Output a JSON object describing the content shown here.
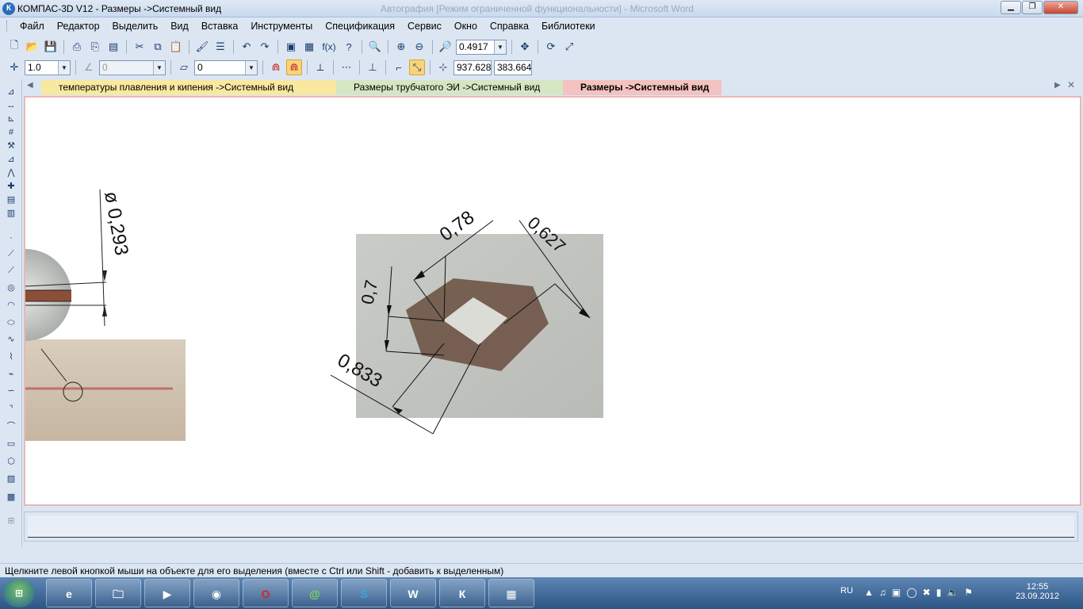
{
  "window": {
    "title": "КОМПАС-3D V12 - Размеры ->Системный вид",
    "ghost_title": "Автография [Режим ограниченной функциональности] - Microsoft Word",
    "app_icon": "kompas-logo-icon"
  },
  "menu": [
    "Файл",
    "Редактор",
    "Выделить",
    "Вид",
    "Вставка",
    "Инструменты",
    "Спецификация",
    "Сервис",
    "Окно",
    "Справка",
    "Библиотеки"
  ],
  "toolbar": {
    "zoom_value": "0.4917",
    "step_value": "1.0",
    "angle_value": "0",
    "layer_value": "0",
    "x_coord": "937.628",
    "y_coord": "383.664",
    "fx_label": "f(x)"
  },
  "tabs": [
    {
      "label": "температуры плавления и кипения ->Системный вид",
      "color": "#f9e8a0"
    },
    {
      "label": "Размеры трубчатого ЭИ ->Системный вид",
      "color": "#d5e6c2"
    },
    {
      "label": "Размеры ->Системный вид",
      "color": "#f4c2c0"
    }
  ],
  "drawing": {
    "left_dimension": "ø 0,293",
    "right_dimensions": [
      "0,78",
      "0,627",
      "0,7",
      "0,833"
    ]
  },
  "status": "Щелкните левой кнопкой мыши на объекте для его выделения (вместе с Ctrl или Shift - добавить к выделенным)",
  "taskbar": {
    "start_icon": "windows-start-icon",
    "apps": [
      "ie-icon",
      "explorer-icon",
      "media-player-icon",
      "mail-icon",
      "opera-icon",
      "chat-icon",
      "skype-icon",
      "word-icon",
      "kompas-icon",
      "calculator-icon"
    ],
    "lang": "RU",
    "time": "12:55",
    "date": "23.09.2012"
  }
}
